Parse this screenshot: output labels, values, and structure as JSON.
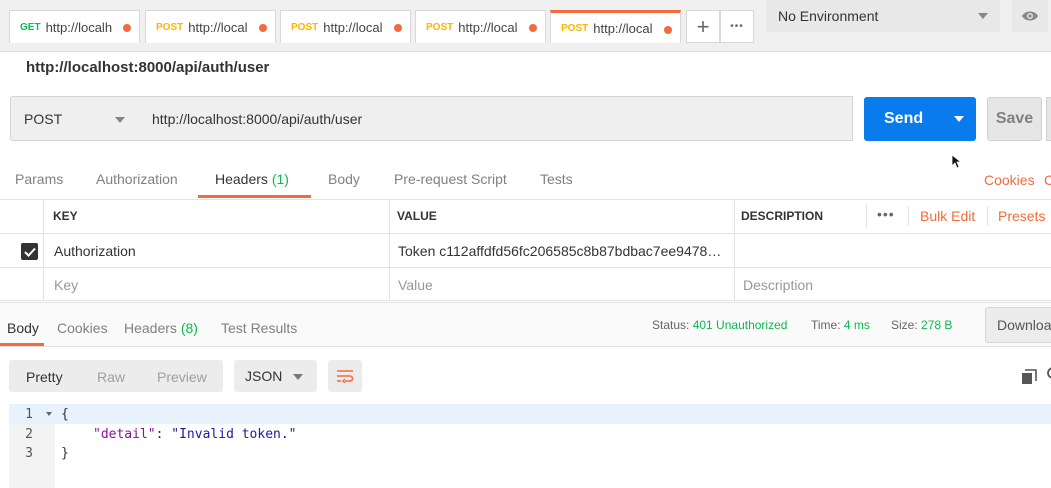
{
  "tabs": [
    {
      "method": "GET",
      "url": "http://localh"
    },
    {
      "method": "POST",
      "url": "http://local"
    },
    {
      "method": "POST",
      "url": "http://local"
    },
    {
      "method": "POST",
      "url": "http://local"
    },
    {
      "method": "POST",
      "url": "http://local"
    }
  ],
  "tab_actions": {
    "add": "+",
    "more": "•••"
  },
  "environment": {
    "selected": "No Environment"
  },
  "request": {
    "title": "http://localhost:8000/api/auth/user",
    "method": "POST",
    "url": "http://localhost:8000/api/auth/user",
    "send_label": "Send",
    "save_label": "Save"
  },
  "request_tabs": {
    "params": "Params",
    "authorization": "Authorization",
    "headers": "Headers",
    "headers_count": "(1)",
    "body": "Body",
    "prerequest": "Pre-request Script",
    "tests": "Tests",
    "cookies": "Cookies",
    "code": "C"
  },
  "headers_table": {
    "columns": {
      "key": "KEY",
      "value": "VALUE",
      "description": "DESCRIPTION"
    },
    "more": "•••",
    "bulk_edit": "Bulk Edit",
    "presets": "Presets",
    "rows": [
      {
        "key": "Authorization",
        "value": "Token c112affdfd56fc206585c8b87bdbac7ee9478…",
        "checked": true
      }
    ],
    "placeholders": {
      "key": "Key",
      "value": "Value",
      "description": "Description"
    }
  },
  "response": {
    "tabs": {
      "body": "Body",
      "cookies": "Cookies",
      "headers": "Headers",
      "headers_count": "(8)",
      "test_results": "Test Results"
    },
    "status_label": "Status:",
    "status_value": "401 Unauthorized",
    "time_label": "Time:",
    "time_value": "4 ms",
    "size_label": "Size:",
    "size_value": "278 B",
    "download": "Downloa",
    "view_tabs": {
      "pretty": "Pretty",
      "raw": "Raw",
      "preview": "Preview"
    },
    "format": "JSON",
    "code_lines": [
      {
        "num": "1",
        "open": "{"
      },
      {
        "num": "2",
        "key": "\"detail\"",
        "sep": ": ",
        "val": "\"Invalid token.\""
      },
      {
        "num": "3",
        "close": "}"
      }
    ]
  },
  "colors": {
    "accent": "#f26b3a",
    "send": "#097bed",
    "status_ok_text": "#0cbb52",
    "post": "#ffb400",
    "get": "#0cbb52"
  }
}
